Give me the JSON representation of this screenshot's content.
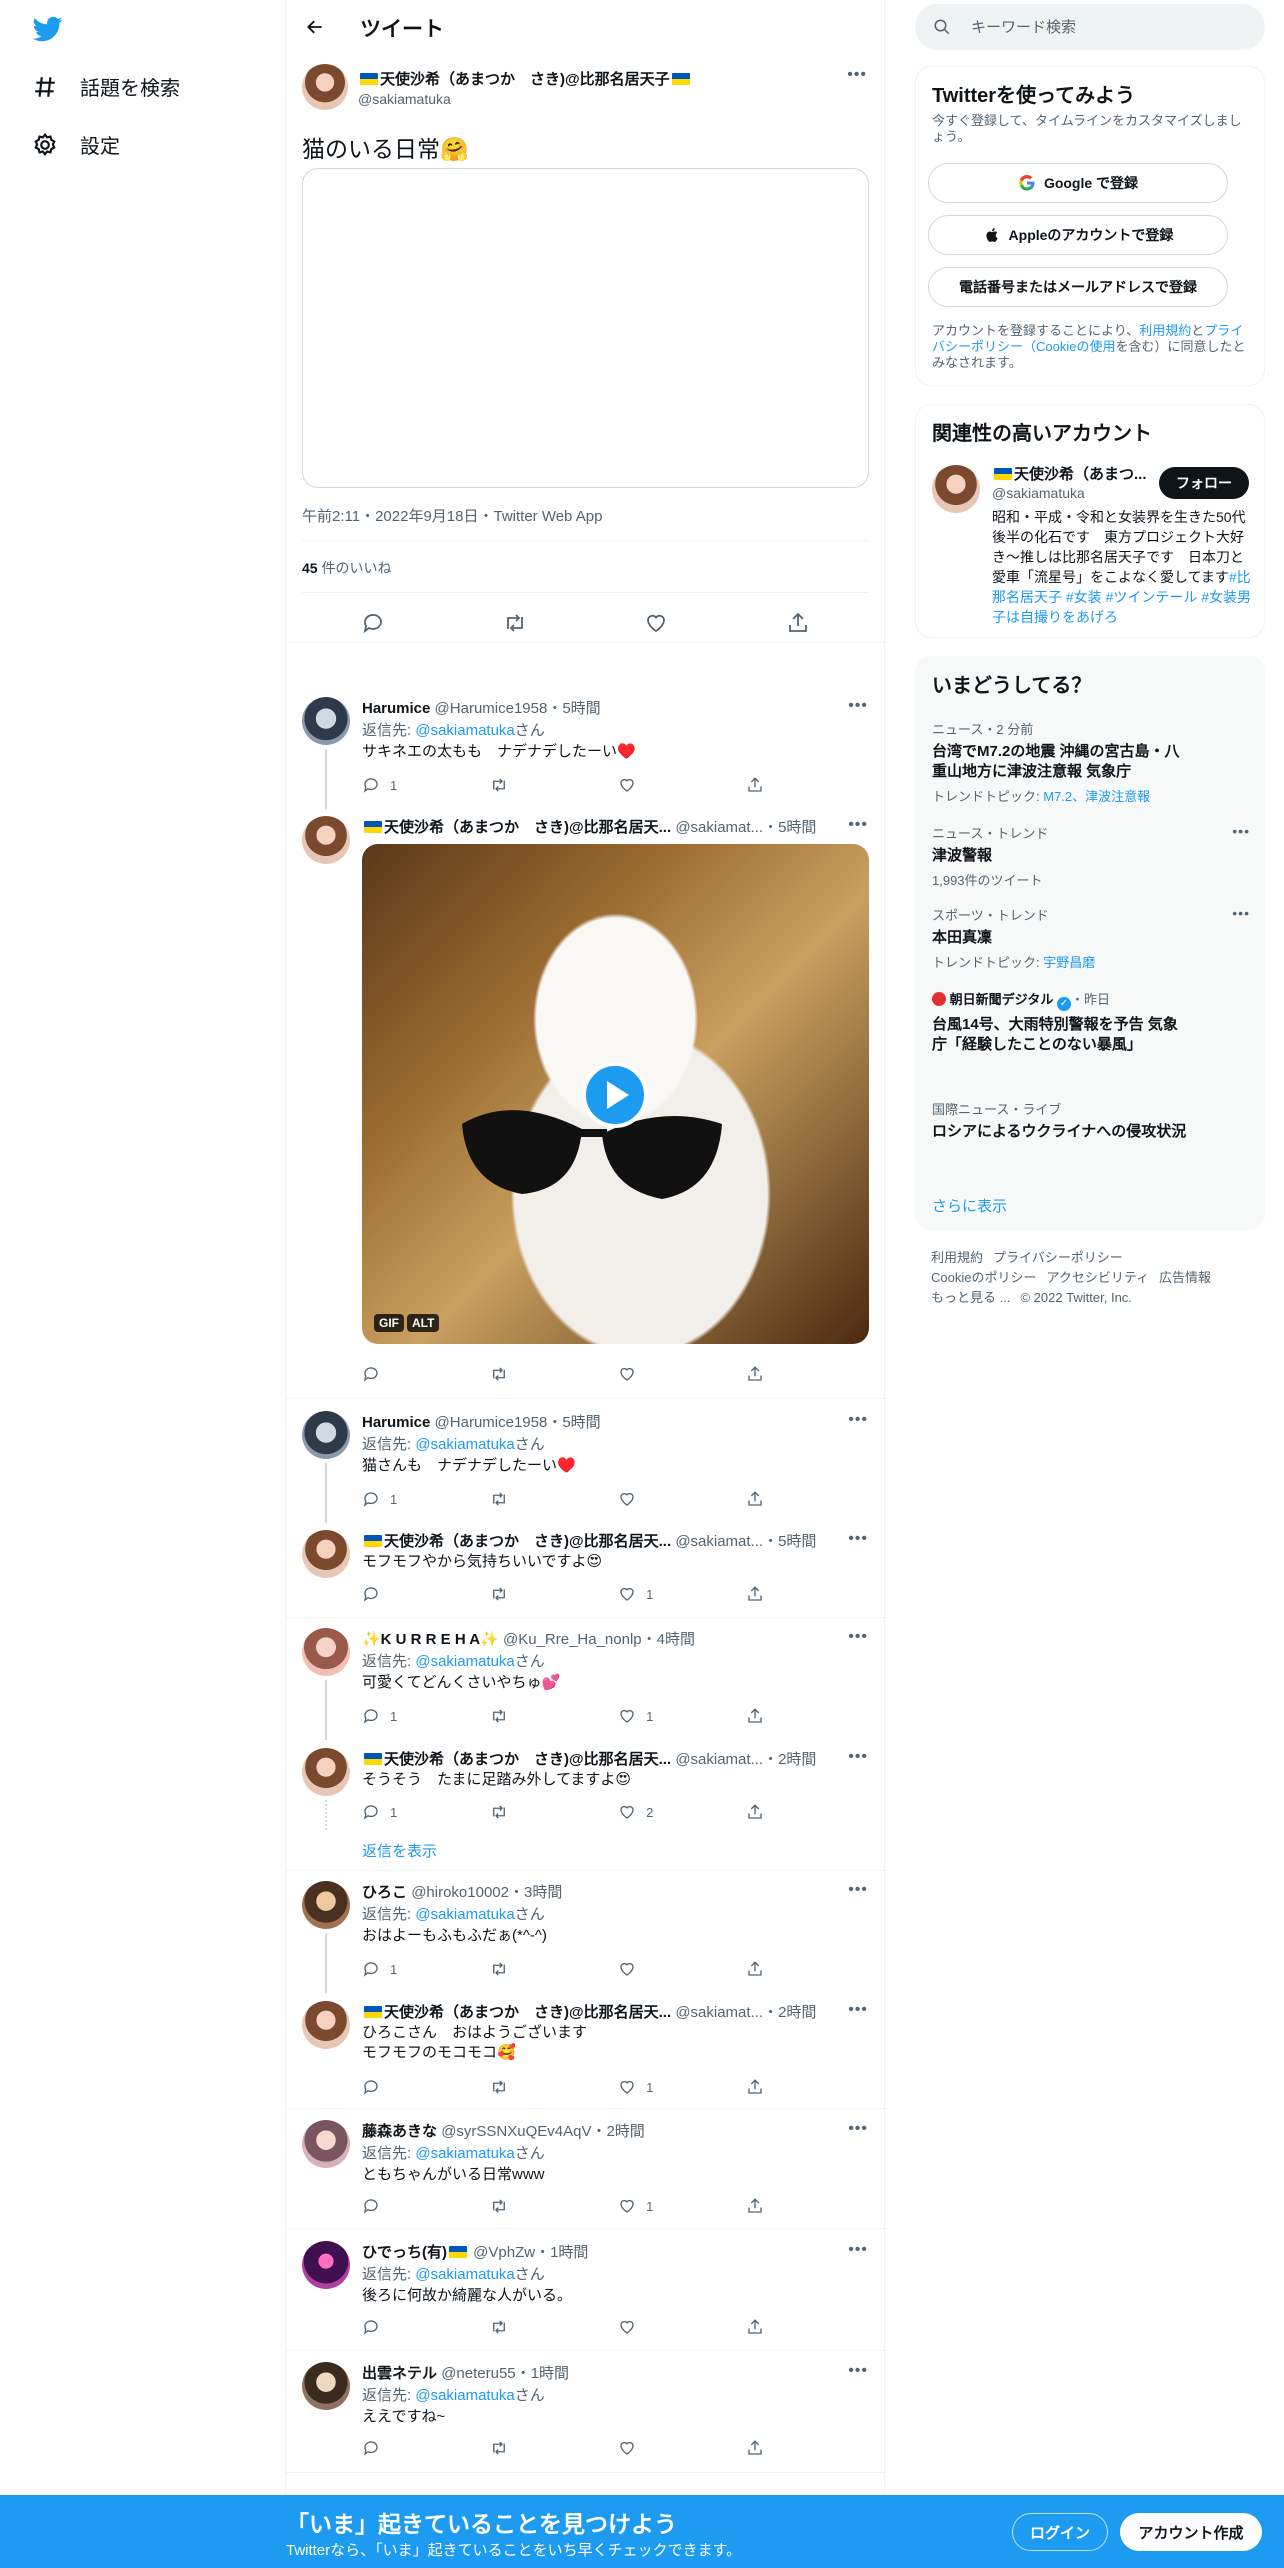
{
  "nav": {
    "explore_label": "話題を検索",
    "settings_label": "設定"
  },
  "header": {
    "title": "ツイート"
  },
  "focus_tweet": {
    "name": "天使沙希（あまつか　さき)@比那名居天子",
    "handle": "@sakiamatuka",
    "text": "猫のいる日常🤗",
    "timestamp": "午前2:11・2022年9月18日・Twitter Web App",
    "like_count": "45",
    "like_label": " 件のいいね"
  },
  "replies": [
    {
      "name": "Harumice",
      "handle": "@Harumice1958",
      "time": "・5時間",
      "reply_prefix": "返信先: ",
      "reply_to": "@sakiamatuka",
      "reply_suffix": "さん",
      "text": "サキネエの太もも　ナデナデしたーい♥️",
      "reply_count": "1",
      "retweet_count": "",
      "like_count": ""
    },
    {
      "name": "天使沙希（あまつか　さき)@比那名居天...",
      "handle": "@sakiamat...",
      "time": "・5時間",
      "gif_tag": "GIF",
      "alt_tag": "ALT",
      "reply_count": "",
      "retweet_count": "",
      "like_count": ""
    },
    {
      "name": "Harumice",
      "handle": "@Harumice1958",
      "time": "・5時間",
      "reply_prefix": "返信先: ",
      "reply_to": "@sakiamatuka",
      "reply_suffix": "さん",
      "text": "猫さんも　ナデナデしたーい♥️",
      "reply_count": "1",
      "retweet_count": "",
      "like_count": ""
    },
    {
      "name": "天使沙希（あまつか　さき)@比那名居天...",
      "handle": "@sakiamat...",
      "time": "・5時間",
      "text": "モフモフやから気持ちいいですよ😍",
      "reply_count": "",
      "retweet_count": "",
      "like_count": "1"
    },
    {
      "name": "✨K U R R E H A✨",
      "handle": "@Ku_Rre_Ha_nonlp",
      "time": "・4時間",
      "reply_prefix": "返信先: ",
      "reply_to": "@sakiamatuka",
      "reply_suffix": "さん",
      "text": "可愛くてどんくさいやちゅ💕",
      "reply_count": "1",
      "retweet_count": "",
      "like_count": "1"
    },
    {
      "name": "天使沙希（あまつか　さき)@比那名居天...",
      "handle": "@sakiamat...",
      "time": "・2時間",
      "text": "そうそう　たまに足踏み外してますよ😍",
      "reply_count": "1",
      "retweet_count": "",
      "like_count": "2"
    },
    {
      "name": "ひろこ",
      "handle": "@hiroko10002",
      "time": "・3時間",
      "reply_prefix": "返信先: ",
      "reply_to": "@sakiamatuka",
      "reply_suffix": "さん",
      "text": "おはよーもふもふだぁ(*^-^)",
      "reply_count": "1",
      "retweet_count": "",
      "like_count": ""
    },
    {
      "name": "天使沙希（あまつか　さき)@比那名居天...",
      "handle": "@sakiamat...",
      "time": "・2時間",
      "text": "ひろこさん　おはようございます",
      "text2": "モフモフのモコモコ🥰",
      "reply_count": "",
      "retweet_count": "",
      "like_count": "1"
    },
    {
      "name": "藤森あきな",
      "handle": "@syrSSNXuQEv4AqV",
      "time": "・2時間",
      "reply_prefix": "返信先: ",
      "reply_to": "@sakiamatuka",
      "reply_suffix": "さん",
      "text": "ともちゃんがいる日常www",
      "reply_count": "",
      "retweet_count": "",
      "like_count": "1"
    },
    {
      "name": "ひでっち(有)",
      "handle": "@VphZw",
      "time": "・1時間",
      "reply_prefix": "返信先: ",
      "reply_to": "@sakiamatuka",
      "reply_suffix": "さん",
      "text": "後ろに何故か綺麗な人がいる。",
      "reply_count": "",
      "retweet_count": "",
      "like_count": ""
    },
    {
      "name": "出雲ネテル",
      "handle": "@neteru55",
      "time": "・1時間",
      "reply_prefix": "返信先: ",
      "reply_to": "@sakiamatuka",
      "reply_suffix": "さん",
      "text": "ええですね~",
      "reply_count": "",
      "retweet_count": "",
      "like_count": ""
    }
  ],
  "show_replies_label": "返信を表示",
  "search": {
    "placeholder": "キーワード検索"
  },
  "signup_panel": {
    "title": "Twitterを使ってみよう",
    "desc": "今すぐ登録して、タイムラインをカスタマイズしましょう。",
    "google_label": "Google で登録",
    "apple_label": "Appleのアカウントで登録",
    "phone_label": "電話番号またはメールアドレスで登録",
    "terms_1": "アカウントを登録することにより、",
    "terms_link1": "利用規約",
    "terms_2": "と",
    "terms_link2": "プライバシーポリシー（Cookieの使用",
    "terms_3": "を含む）に同意したとみなされます。"
  },
  "relevant_panel": {
    "title": "関連性の高いアカウント",
    "name": "天使沙希（あまつ...",
    "handle": "@sakiamatuka",
    "follow_label": "フォロー",
    "bio": "昭和・平成・令和と女装界を生きた50代後半の化石です　東方プロジェクト大好き～推しは比那名居天子です　日本刀と愛車「流星号」をこよなく愛してます",
    "bio_tags": "#比那名居天子 #女装 #ツインテール #女装男子は自撮りをあげろ"
  },
  "trends_panel": {
    "title": "いまどうしてる？",
    "items": [
      {
        "cat": "ニュース・2 分前",
        "title": "台湾でM7.2の地震 沖縄の宮古島・八重山地方に津波注意報 気象庁",
        "sub_prefix": "トレンドトピック: ",
        "sub_link": "M7.2、津波注意報"
      },
      {
        "cat": "ニュース・トレンド",
        "title": "津波警報",
        "sub": "1,993件のツイート"
      },
      {
        "cat": "スポーツ・トレンド",
        "title": "本田真凜",
        "sub_prefix": "トレンドトピック: ",
        "sub_link": "宇野昌磨"
      },
      {
        "cat_name": "朝日新聞デジタル",
        "cat_time": "・昨日",
        "title": "台風14号、大雨特別警報を予告 気象庁「経験したことのない暴風」"
      },
      {
        "cat": "国際ニュース・ライブ",
        "title": "ロシアによるウクライナへの侵攻状況"
      }
    ],
    "more_label": "さらに表示"
  },
  "footer": {
    "links": [
      "利用規約",
      "プライバシーポリシー",
      "Cookieのポリシー",
      "アクセシビリティ",
      "広告情報",
      "もっと見る ..."
    ],
    "copyright": "© 2022 Twitter, Inc."
  },
  "bottom_bar": {
    "title": "「いま」起きていることを見つけよう",
    "subtitle": "Twitterなら、「いま」起きていることをいち早くチェックできます。",
    "login_label": "ログイン",
    "signup_label": "アカウント作成"
  },
  "colors": {
    "accent": "#1d9bf0",
    "text": "#0f1419",
    "muted": "#536471",
    "like_heart": "#f91880"
  }
}
